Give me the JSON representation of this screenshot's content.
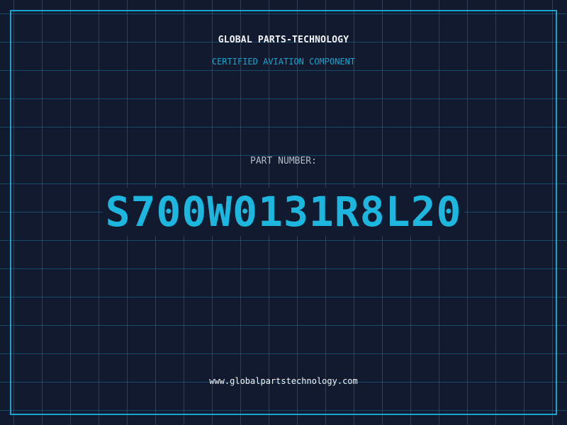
{
  "header": {
    "company": "GLOBAL PARTS-TECHNOLOGY",
    "subtitle": "CERTIFIED AVIATION COMPONENT"
  },
  "part": {
    "label": "PART NUMBER:",
    "number": "S700W0131R8L20"
  },
  "footer": {
    "url": "www.globalpartstechnology.com"
  },
  "colors": {
    "background": "#111a2e",
    "accent": "#1aa3cc",
    "text": "#f2f4f8"
  }
}
